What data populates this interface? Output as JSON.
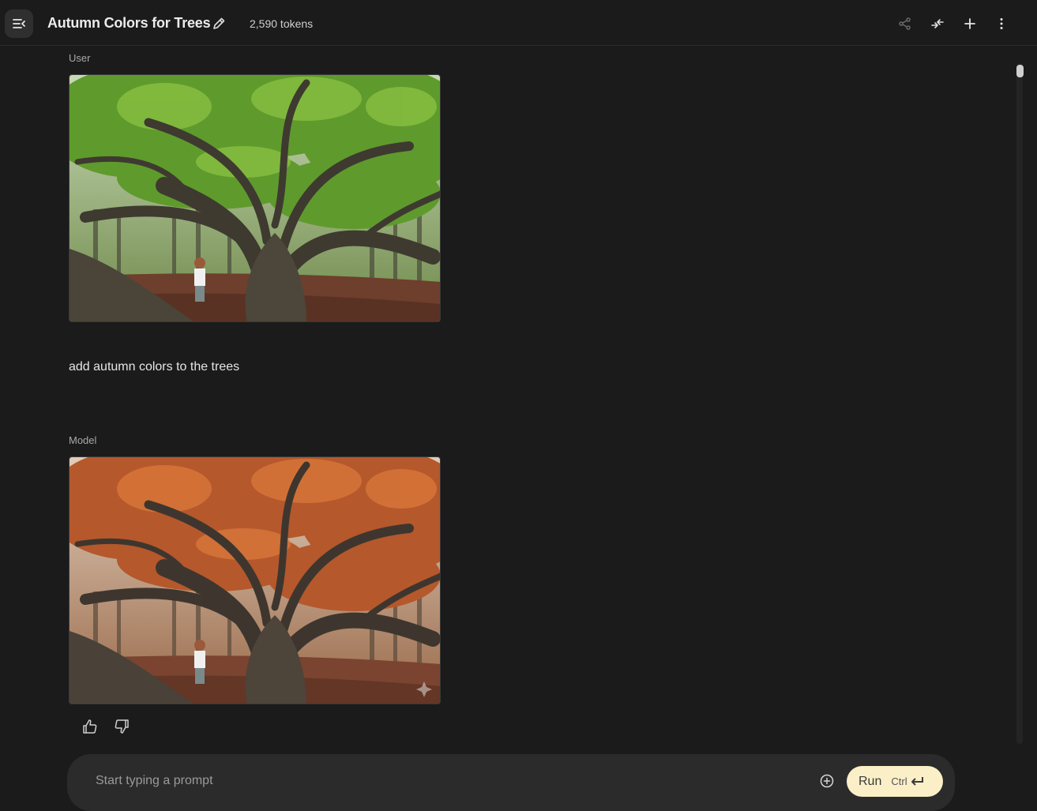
{
  "header": {
    "title": "Autumn Colors for Trees",
    "tokens": "2,590 tokens",
    "icons": [
      "menu-collapse-icon",
      "edit-icon",
      "share-icon",
      "compare-icon",
      "add-icon",
      "more-vert-icon"
    ]
  },
  "messages": [
    {
      "role": "User",
      "image": "photo of a large live oak tree with green foliage and a child standing at its base",
      "text": "add autumn colors to the trees"
    },
    {
      "role": "Model",
      "image": "same live oak tree photo recolored with orange autumn foliage"
    }
  ],
  "feedback": {
    "icons": [
      "thumb-up-icon",
      "thumb-down-icon"
    ]
  },
  "prompt": {
    "placeholder": "Start typing a prompt",
    "value": "",
    "run_label": "Run",
    "run_shortcut": "Ctrl"
  },
  "colors": {
    "background": "#1b1b1b",
    "prompt_bar": "#2b2b2b",
    "run_button": "#fbefc7"
  }
}
